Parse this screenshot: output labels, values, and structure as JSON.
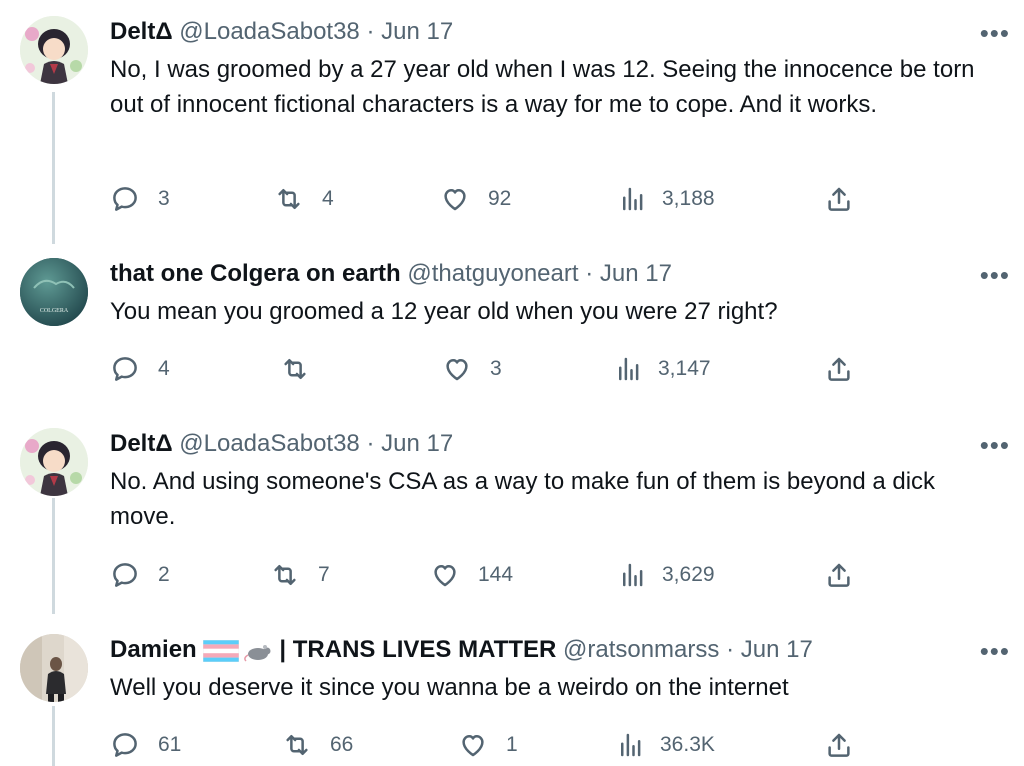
{
  "tweets": [
    {
      "name": "DeltΔ",
      "handle": "@LoadaSabot38",
      "date": "Jun 17",
      "text": "No, I was groomed by a 27 year old when I was 12. Seeing the innocence be torn out of innocent fictional characters is a way for me to cope. And it works.",
      "replies": "3",
      "retweets": "4",
      "likes": "92",
      "views": "3,188"
    },
    {
      "name": "that one Colgera on earth",
      "handle": "@thatguyoneart",
      "date": "Jun 17",
      "avatar_text": "COLGERA",
      "text": "You mean you groomed a 12 year old when you were 27 right?",
      "replies": "4",
      "retweets": "",
      "likes": "3",
      "views": "3,147"
    },
    {
      "name": "DeltΔ",
      "handle": "@LoadaSabot38",
      "date": "Jun 17",
      "text": "No. And using someone's CSA as a way to make fun of them is beyond a dick move.",
      "replies": "2",
      "retweets": "7",
      "likes": "144",
      "views": "3,629"
    },
    {
      "name": "Damien",
      "name_suffix": "| TRANS LIVES MATTER",
      "handle": "@ratsonmarss",
      "date": "Jun 17",
      "text": "Well you deserve it since you wanna be a weirdo on the internet",
      "replies": "61",
      "retweets": "66",
      "likes": "1",
      "views": "36.3K"
    }
  ],
  "separator": "·",
  "more_label": "•••",
  "icons": [
    "reply-icon",
    "retweet-icon",
    "like-icon",
    "views-icon",
    "share-icon"
  ],
  "colors": {
    "text": "#0f1419",
    "secondary": "#536471",
    "thread_line": "#cfd9de"
  }
}
